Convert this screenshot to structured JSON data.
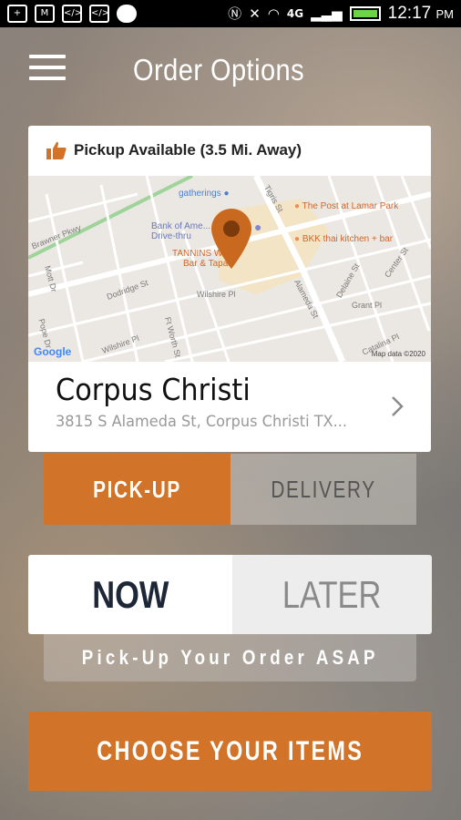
{
  "status_bar": {
    "time": "12:17",
    "ampm": "PM",
    "network": "4G"
  },
  "header": {
    "title": "Order Options"
  },
  "location": {
    "availability": "Pickup Available (3.5 Mi. Away)",
    "name": "Corpus Christi",
    "address": "3815 S Alameda St, Corpus Christi TX...",
    "map": {
      "street_labels": [
        "Brawner Pkwy",
        "Dodridge St",
        "Wilshire Pl",
        "Tigris St",
        "Alameda St",
        "Grant Pl",
        "Delaine St",
        "Catalina Pl",
        "Ft Worth St",
        "Pope Dr",
        "Mott Dr",
        "Center St",
        "Wilshire Pl"
      ],
      "pois": {
        "gatherings": "gatherings",
        "bank": "Bank of Ame...",
        "bank_sub": "Drive-thru",
        "tannins": "TANNINS W...",
        "tannins_sub": "Bar & Tapas",
        "post": "The Post at Lamar Park",
        "bkk": "BKK thai kitchen + bar"
      },
      "google": "Google",
      "map_data": "Map data ©2020"
    }
  },
  "order_mode": {
    "pickup": "PICK-UP",
    "delivery": "DELIVERY",
    "selected": "PICK-UP"
  },
  "order_time": {
    "now": "NOW",
    "later": "LATER",
    "selected": "NOW",
    "note": "Pick-Up Your Order ASAP"
  },
  "cta": {
    "label": "CHOOSE YOUR ITEMS"
  },
  "colors": {
    "accent": "#d1742a",
    "pin": "#c8691f",
    "now_text": "#1e2738"
  }
}
